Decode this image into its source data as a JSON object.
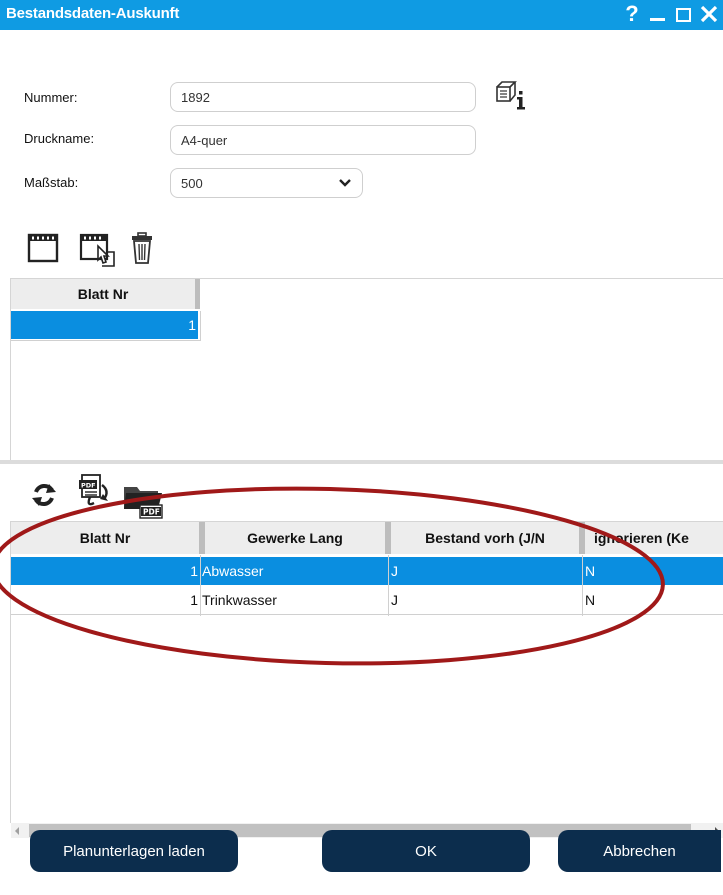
{
  "window": {
    "title": "Bestandsdaten-Auskunft",
    "help_label": "?"
  },
  "form": {
    "nummer_label": "Nummer:",
    "nummer_value": "1892",
    "druckname_label": "Druckname:",
    "druckname_value": "A4-quer",
    "massstab_label": "Maßstab:",
    "massstab_value": "500"
  },
  "sheets": {
    "columns": [
      "Blatt Nr"
    ],
    "rows": [
      {
        "blatt_nr": "1"
      }
    ]
  },
  "trades": {
    "columns": [
      "Blatt Nr",
      "Gewerke Lang",
      "Bestand vorh (J/N",
      "ignorieren (Ke"
    ],
    "rows": [
      {
        "blatt_nr": "1",
        "gewerk": "Abwasser",
        "bestand": "J",
        "ignorieren": "N"
      },
      {
        "blatt_nr": "1",
        "gewerk": "Trinkwasser",
        "bestand": "J",
        "ignorieren": "N"
      }
    ]
  },
  "buttons": {
    "load": "Planunterlagen laden",
    "ok": "OK",
    "cancel": "Abbrechen"
  },
  "colors": {
    "titlebar": "#0f9be3",
    "selection": "#0a8ee0",
    "button": "#0c2d4d",
    "annotation": "#a01919"
  },
  "icons": [
    "info-sheet-icon",
    "new-sheet-icon",
    "edit-sheet-icon",
    "delete-icon",
    "refresh-icon",
    "pdf-export-icon",
    "pdf-folder-icon"
  ]
}
